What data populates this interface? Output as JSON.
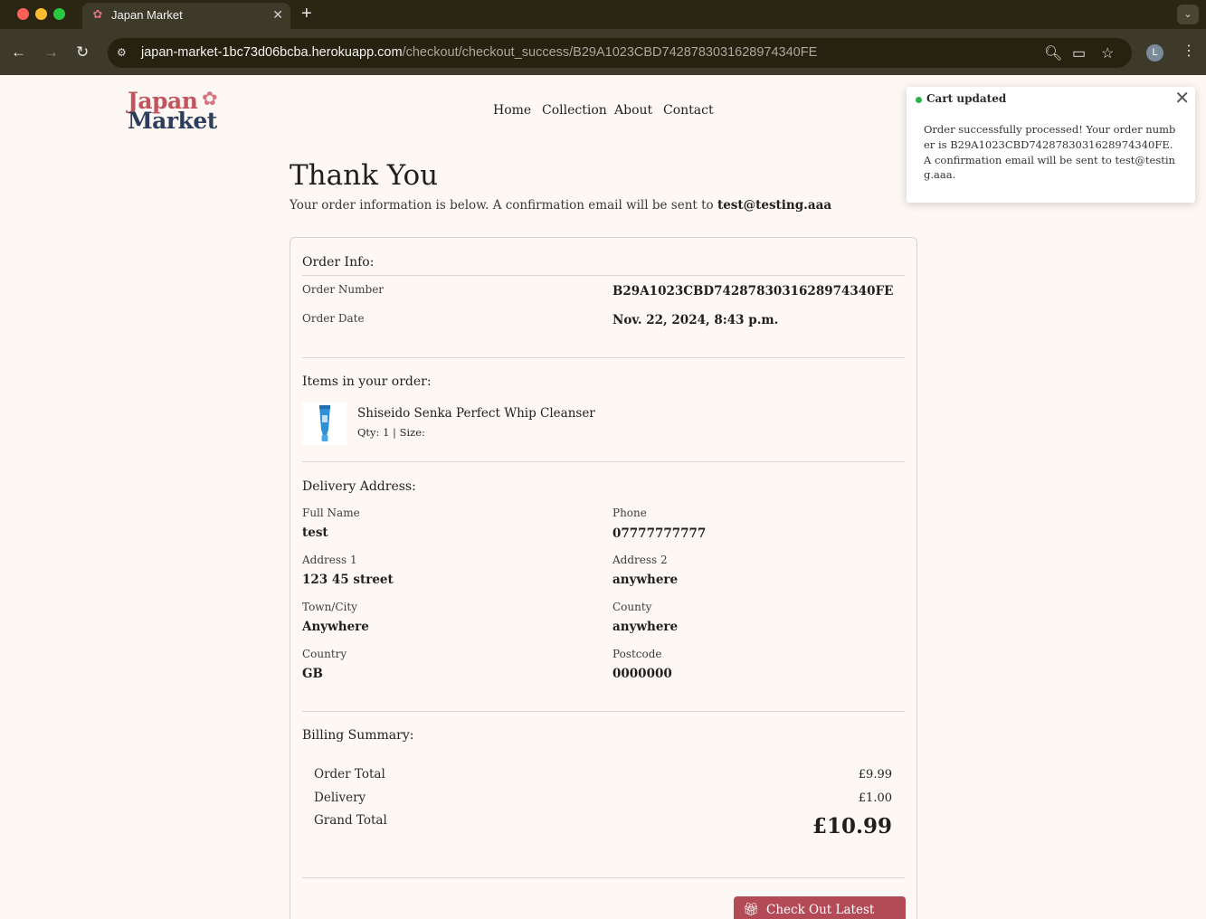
{
  "browser": {
    "tab_title": "Japan Market",
    "tab_favicon": "✿",
    "tab_close": "✕",
    "new_tab": "+",
    "tab_menu": "⌄",
    "url_host": "japan-market-1bc73d06bcba.herokuapp.com",
    "url_path": "/checkout/checkout_success/B29A1023CBD7428783031628974340FE",
    "avatar_letter": "L"
  },
  "header": {
    "logo_line1": "Japan",
    "logo_line2": "Market",
    "logo_flower": "✿",
    "nav": [
      "Home",
      "Collection",
      "About",
      "Contact"
    ]
  },
  "page": {
    "title": "Thank You",
    "intro_text": "Your order information is below. A confirmation email will be sent to",
    "email": "test@testing.aaa"
  },
  "order_info": {
    "heading": "Order Info:",
    "number_label": "Order Number",
    "number_value": "B29A1023CBD7428783031628974340FE",
    "date_label": "Order Date",
    "date_value": "Nov. 22, 2024, 8:43 p.m."
  },
  "items": {
    "heading": "Items in your order:",
    "list": [
      {
        "name": "Shiseido Senka Perfect Whip Cleanser",
        "meta": "Qty: 1 | Size:"
      }
    ]
  },
  "delivery": {
    "heading": "Delivery Address:",
    "fields": [
      {
        "label": "Full Name",
        "value": "test"
      },
      {
        "label": "Phone",
        "value": "07777777777"
      },
      {
        "label": "Address 1",
        "value": "123 45 street"
      },
      {
        "label": "Address 2",
        "value": "anywhere"
      },
      {
        "label": "Town/City",
        "value": "Anywhere"
      },
      {
        "label": "County",
        "value": "anywhere"
      },
      {
        "label": "Country",
        "value": "GB"
      },
      {
        "label": "Postcode",
        "value": "0000000"
      }
    ]
  },
  "billing": {
    "heading": "Billing Summary:",
    "order_total_label": "Order Total",
    "order_total_value": "£9.99",
    "delivery_label": "Delivery",
    "delivery_value": "£1.00",
    "grand_total_label": "Grand Total",
    "grand_total_value": "£10.99"
  },
  "cta": {
    "label": "Check Out Latest Deals",
    "icon": "gift-icon"
  },
  "toast": {
    "title": "Cart updated",
    "body": "Order successfully processed! Your order number is B29A1023CBD7428783031628974340FE. A confirmation email will be sent to test@testing.aaa.",
    "status_color": "#2db24a"
  },
  "colors": {
    "brand_red": "#c2545d",
    "brand_navy": "#2d3e5c",
    "button": "#b34b57",
    "page_bg": "#fdf8f4"
  }
}
